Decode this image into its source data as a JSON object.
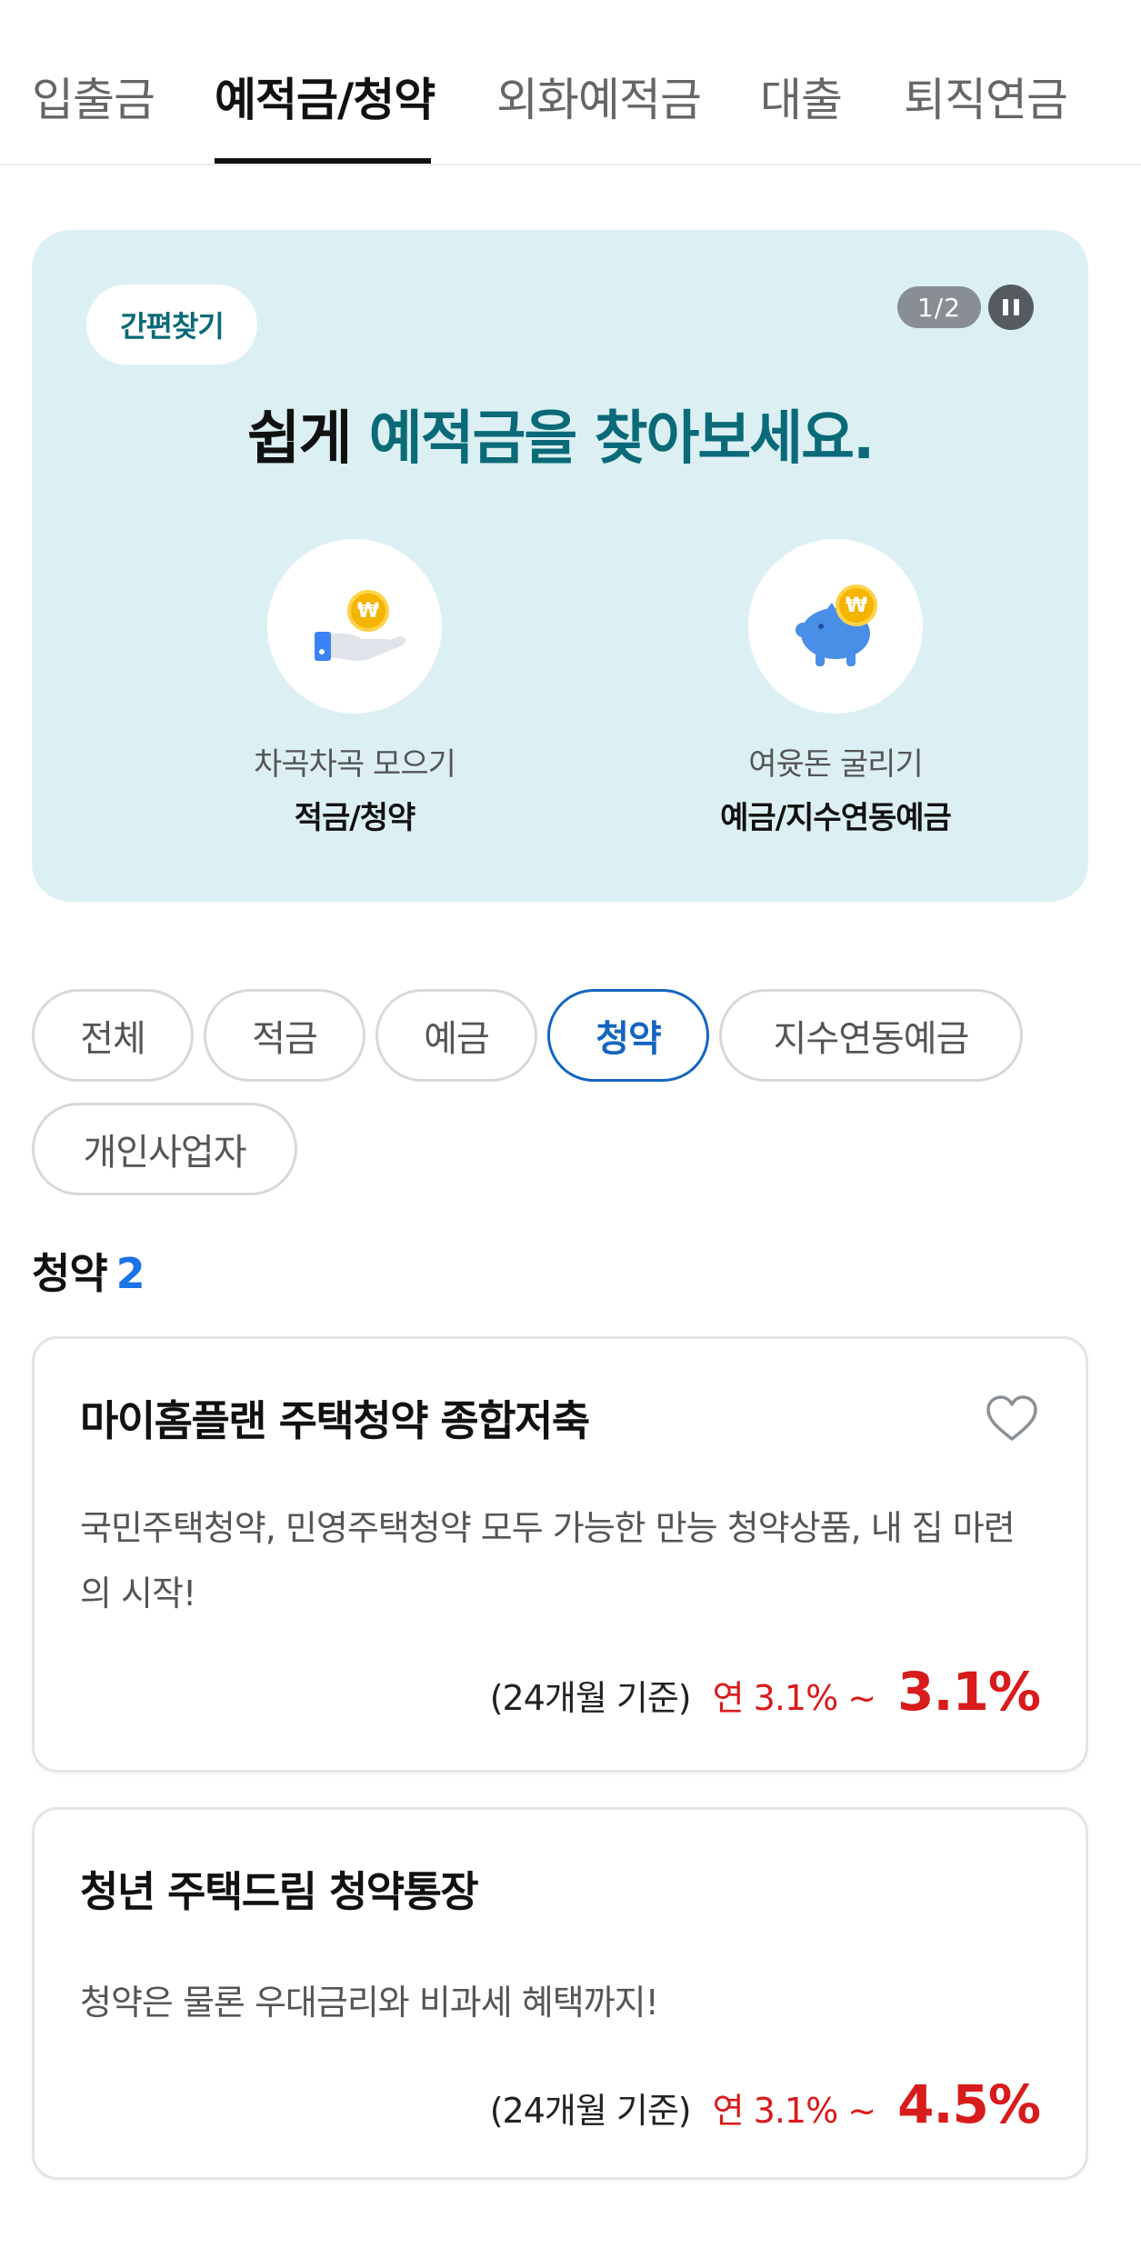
{
  "tabs": [
    {
      "label": "입출금",
      "active": false
    },
    {
      "label": "예적금/청약",
      "active": true
    },
    {
      "label": "외화예적금",
      "active": false
    },
    {
      "label": "대출",
      "active": false
    },
    {
      "label": "퇴직연금",
      "active": false
    }
  ],
  "banner": {
    "chip": "간편찾기",
    "pager": "1/2",
    "title_prefix": "쉽게",
    "title_highlight": "예적금을 찾아보세요.",
    "options": [
      {
        "sub": "차곡차곡 모으기",
        "main": "적금/청약",
        "icon": "hand-coin-icon"
      },
      {
        "sub": "여윳돈 굴리기",
        "main": "예금/지수연동예금",
        "icon": "piggy-bank-icon"
      }
    ],
    "coin_symbol": "₩",
    "bg_color": "#dcf0f4",
    "accent_color": "#0a6a78"
  },
  "filters": [
    {
      "label": "전체",
      "active": false
    },
    {
      "label": "적금",
      "active": false
    },
    {
      "label": "예금",
      "active": false
    },
    {
      "label": "청약",
      "active": true
    },
    {
      "label": "지수연동예금",
      "active": false
    },
    {
      "label": "개인사업자",
      "active": false
    }
  ],
  "section": {
    "title": "청약",
    "count": "2"
  },
  "products": [
    {
      "title": "마이홈플랜 주택청약 종합저축",
      "desc": "국민주택청약, 민영주택청약 모두 가능한 만능 청약상품, 내 집 마련의 시작!",
      "basis": "(24개월 기준)",
      "range": "연 3.1% ~",
      "max": "3.1%"
    },
    {
      "title": "청년 주택드림 청약통장",
      "desc": "청약은 물론 우대금리와 비과세 혜택까지!",
      "basis": "(24개월 기준)",
      "range": "연 3.1% ~",
      "max": "4.5%"
    }
  ],
  "colors": {
    "rate_red": "#d81b1b",
    "active_blue": "#1565c0",
    "count_blue": "#1a73e8"
  }
}
